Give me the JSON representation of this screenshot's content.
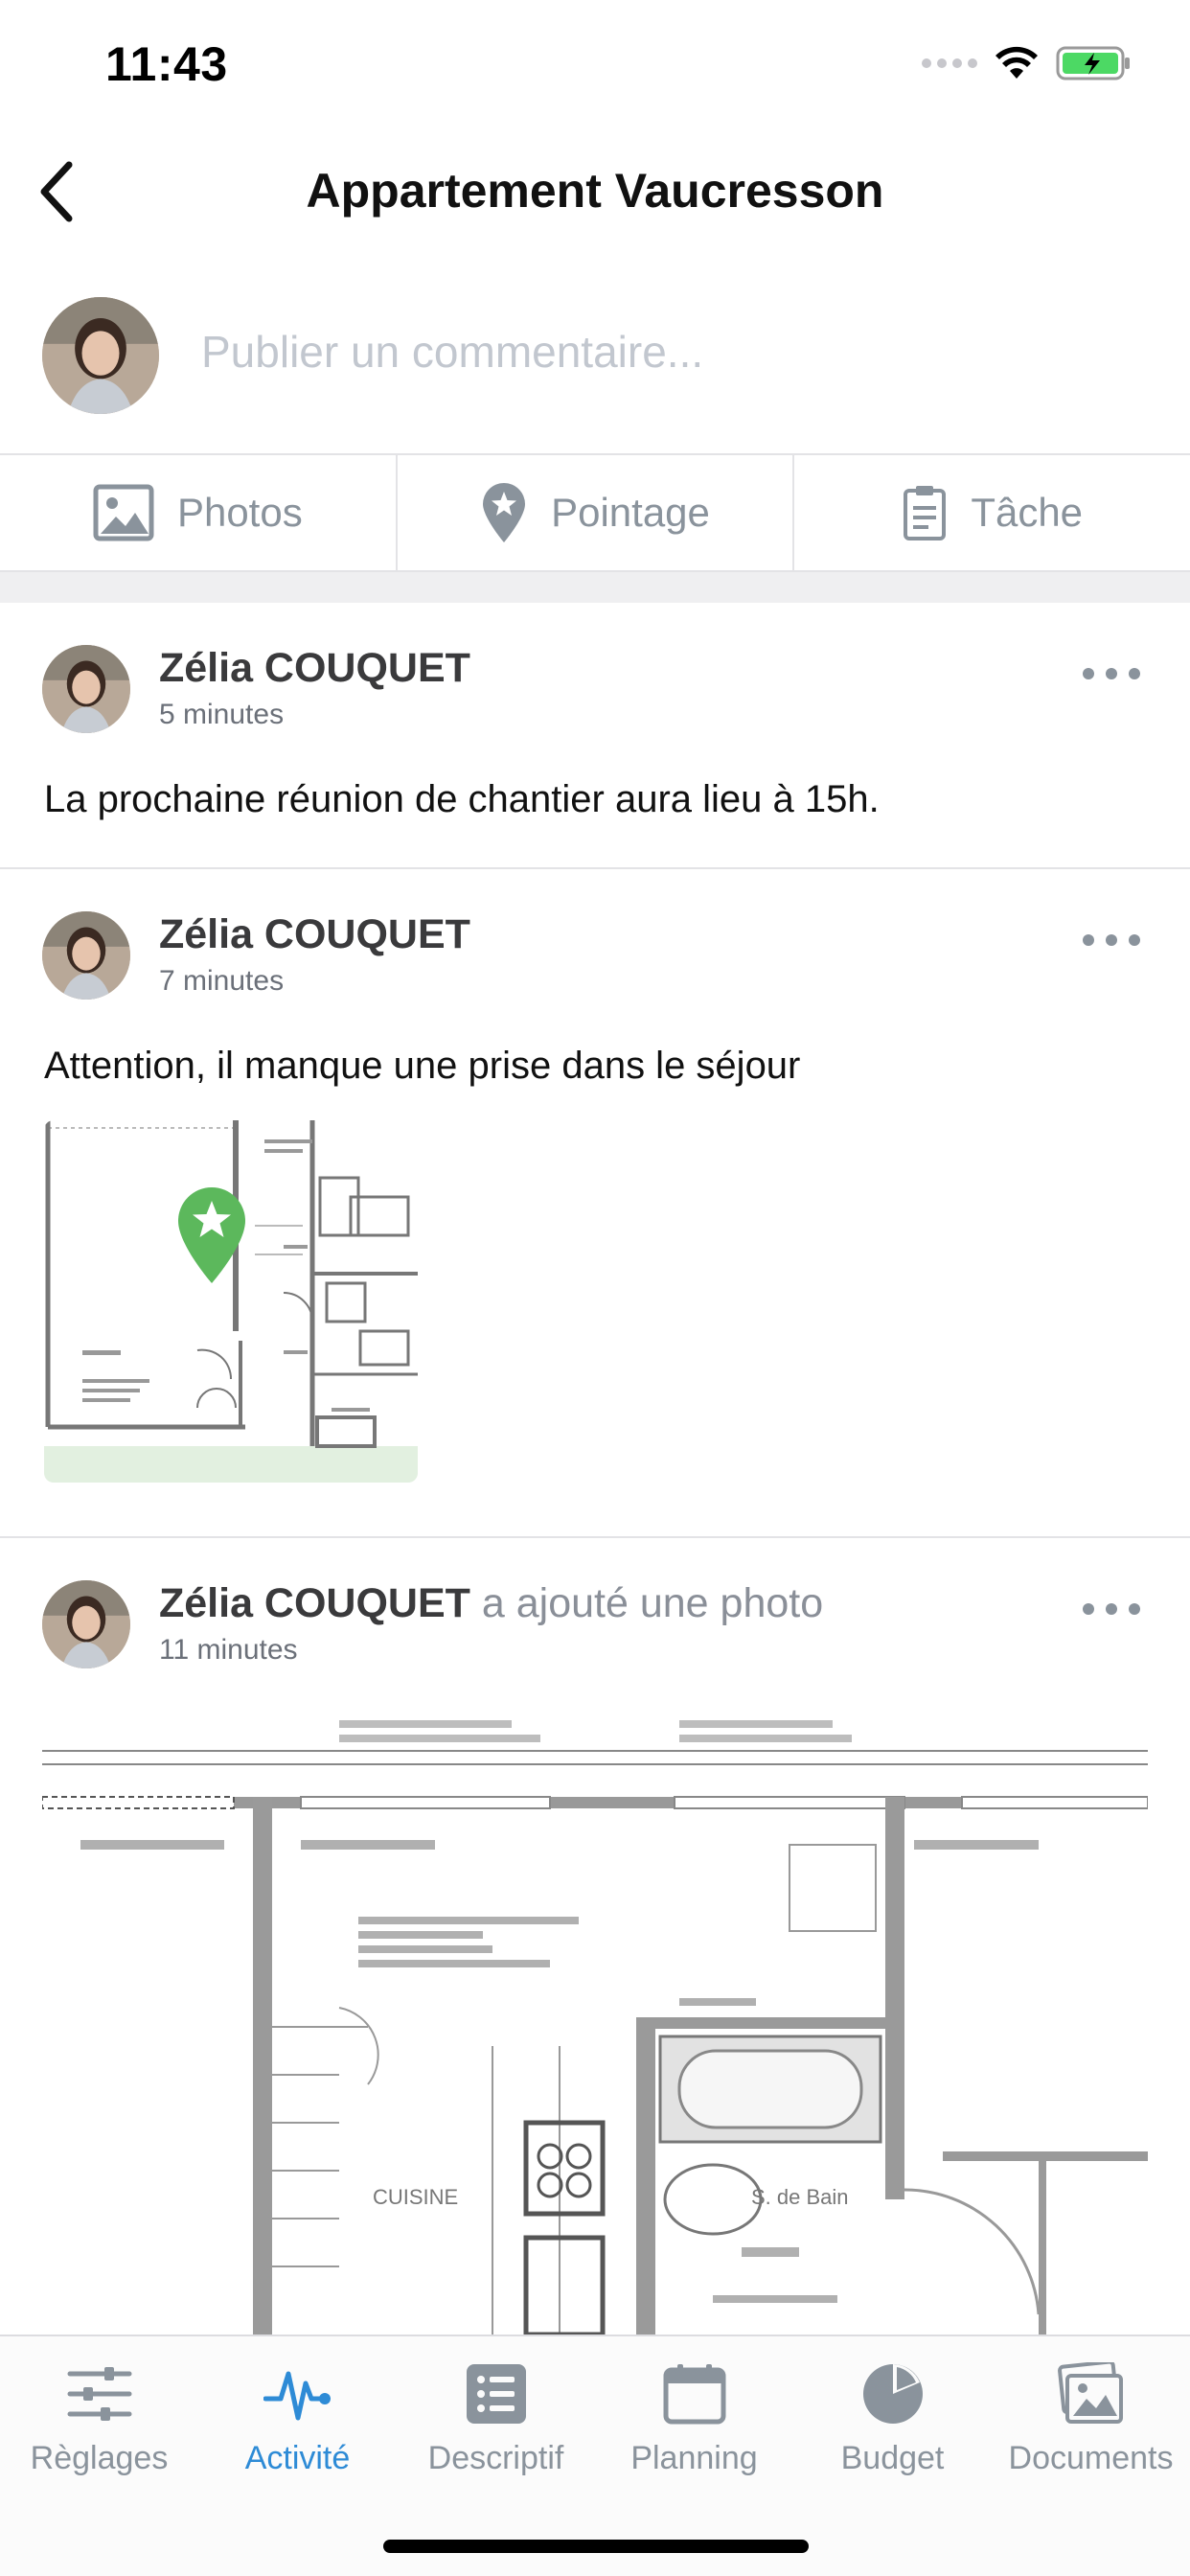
{
  "status_bar": {
    "time": "11:43"
  },
  "header": {
    "title": "Appartement Vaucresson"
  },
  "composer": {
    "placeholder": "Publier un commentaire..."
  },
  "actions": [
    {
      "label": "Photos",
      "icon": "image-icon"
    },
    {
      "label": "Pointage",
      "icon": "pin-star-icon"
    },
    {
      "label": "Tâche",
      "icon": "clipboard-icon"
    }
  ],
  "posts": [
    {
      "author": "Zélia COUQUET",
      "action": "",
      "time": "5 minutes",
      "text": "La prochaine réunion de chantier aura lieu à 15h."
    },
    {
      "author": "Zélia COUQUET",
      "action": "",
      "time": "7 minutes",
      "text": "Attention, il manque une prise dans le séjour"
    },
    {
      "author": "Zélia COUQUET",
      "action": "a ajouté une photo",
      "time": "11 minutes",
      "text": ""
    }
  ],
  "tabs": [
    {
      "label": "Règlages",
      "icon": "sliders-icon",
      "active": false
    },
    {
      "label": "Activité",
      "icon": "pulse-icon",
      "active": true
    },
    {
      "label": "Descriptif",
      "icon": "list-icon",
      "active": false
    },
    {
      "label": "Planning",
      "icon": "calendar-icon",
      "active": false
    },
    {
      "label": "Budget",
      "icon": "pie-chart-icon",
      "active": false
    },
    {
      "label": "Documents",
      "icon": "images-icon",
      "active": false
    }
  ],
  "colors": {
    "accent": "#2e8bd6",
    "pin_green": "#5cb85c",
    "muted": "#8a939c"
  }
}
